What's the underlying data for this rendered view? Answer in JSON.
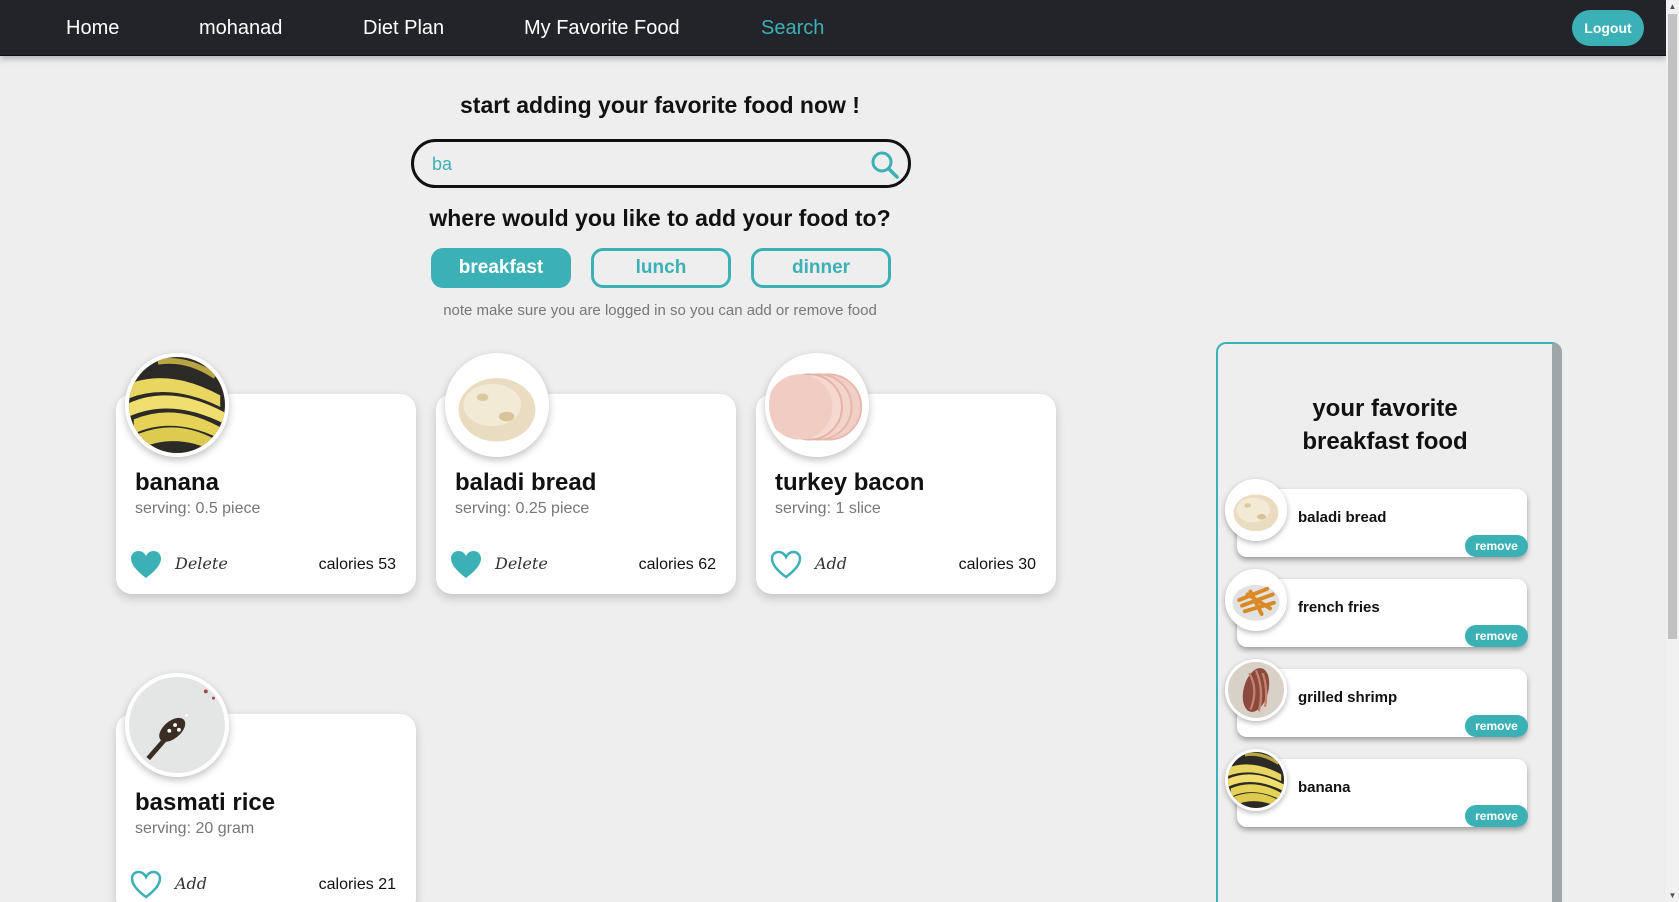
{
  "nav": {
    "items": [
      {
        "label": "Home"
      },
      {
        "label": "mohanad"
      },
      {
        "label": "Diet Plan"
      },
      {
        "label": "My Favorite Food"
      },
      {
        "label": "Search"
      }
    ],
    "active": "Search",
    "logout_label": "Logout"
  },
  "search_section": {
    "title": "start adding your favorite food now !",
    "search_value": "ba",
    "meal_prompt": "where would you like to add your food to?",
    "meals": [
      "breakfast",
      "lunch",
      "dinner"
    ],
    "selected_meal": "breakfast",
    "note": "note make sure you are logged in so you can add or remove food"
  },
  "foods": [
    {
      "name": "banana",
      "serving": "serving: 0.5 piece",
      "action": "Delete",
      "favorited": true,
      "calories": "calories 53"
    },
    {
      "name": "baladi bread",
      "serving": "serving: 0.25 piece",
      "action": "Delete",
      "favorited": true,
      "calories": "calories 62"
    },
    {
      "name": "turkey bacon",
      "serving": "serving: 1 slice",
      "action": "Add",
      "favorited": false,
      "calories": "calories 30"
    },
    {
      "name": "basmati rice",
      "serving": "serving: 20 gram",
      "action": "Add",
      "favorited": false,
      "calories": "calories 21"
    }
  ],
  "favorites_panel": {
    "title_line1": "your favorite",
    "title_line2": "breakfast food",
    "items": [
      {
        "name": "baladi bread",
        "remove_label": "remove"
      },
      {
        "name": "french fries",
        "remove_label": "remove"
      },
      {
        "name": "grilled shrimp",
        "remove_label": "remove"
      },
      {
        "name": "banana",
        "remove_label": "remove"
      }
    ]
  },
  "colors": {
    "accent": "#3cb1b5",
    "navbar": "#222429",
    "background": "#eeeeee"
  }
}
